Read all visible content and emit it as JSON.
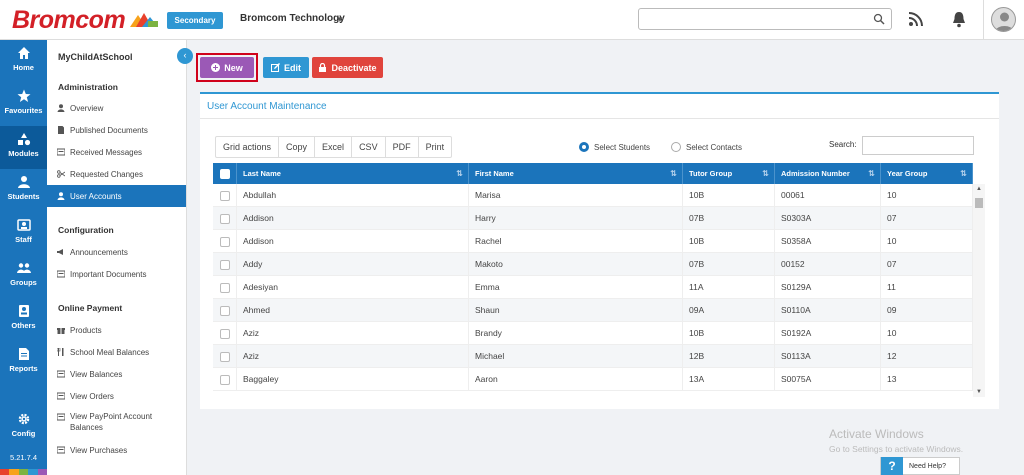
{
  "header": {
    "logo": "Bromcom",
    "secondary_label": "Secondary",
    "organisation": "Bromcom Technology",
    "search_placeholder": ""
  },
  "leftnav": {
    "items": [
      {
        "label": "Home",
        "icon": "home-icon"
      },
      {
        "label": "Favourites",
        "icon": "star-icon"
      },
      {
        "label": "Modules",
        "icon": "modules-icon"
      },
      {
        "label": "Students",
        "icon": "students-icon"
      },
      {
        "label": "Staff",
        "icon": "staff-icon"
      },
      {
        "label": "Groups",
        "icon": "groups-icon"
      },
      {
        "label": "Others",
        "icon": "others-icon"
      },
      {
        "label": "Reports",
        "icon": "reports-icon"
      },
      {
        "label": "Config",
        "icon": "config-icon"
      }
    ],
    "version": "5.21.7.4"
  },
  "sidebar": {
    "title": "MyChildAtSchool",
    "sections": [
      {
        "title": "Administration",
        "items": [
          "Overview",
          "Published Documents",
          "Received Messages",
          "Requested Changes",
          "User Accounts"
        ]
      },
      {
        "title": "Configuration",
        "items": [
          "Announcements",
          "Important Documents"
        ]
      },
      {
        "title": "Online Payment",
        "items": [
          "Products",
          "School Meal Balances",
          "View Balances",
          "View Orders",
          "View PayPoint Account Balances",
          "View Purchases"
        ]
      }
    ]
  },
  "toolbar": {
    "new_label": "New",
    "edit_label": "Edit",
    "deactivate_label": "Deactivate"
  },
  "panel": {
    "title": "User Account Maintenance",
    "grid_actions": [
      "Grid actions",
      "Copy",
      "Excel",
      "CSV",
      "PDF",
      "Print"
    ],
    "radio_students": "Select Students",
    "radio_contacts": "Select Contacts",
    "search_label": "Search:",
    "search_value": ""
  },
  "table": {
    "columns": [
      "Last Name",
      "First Name",
      "Tutor Group",
      "Admission Number",
      "Year Group"
    ],
    "rows": [
      [
        "Abdullah",
        "Marisa",
        "10B",
        "00061",
        "10"
      ],
      [
        "Addison",
        "Harry",
        "07B",
        "S0303A",
        "07"
      ],
      [
        "Addison",
        "Rachel",
        "10B",
        "S0358A",
        "10"
      ],
      [
        "Addy",
        "Makoto",
        "07B",
        "00152",
        "07"
      ],
      [
        "Adesiyan",
        "Emma",
        "11A",
        "S0129A",
        "11"
      ],
      [
        "Ahmed",
        "Shaun",
        "09A",
        "S0110A",
        "09"
      ],
      [
        "Aziz",
        "Brandy",
        "10B",
        "S0192A",
        "10"
      ],
      [
        "Aziz",
        "Michael",
        "12B",
        "S0113A",
        "12"
      ],
      [
        "Baggaley",
        "Aaron",
        "13A",
        "S0075A",
        "13"
      ]
    ]
  },
  "watermark": {
    "line1": "Activate Windows",
    "line2": "Go to Settings to activate Windows."
  },
  "help": {
    "q": "?",
    "label": "Need Help?"
  },
  "colors": {
    "brand_red": "#d32027",
    "primary_blue": "#1b74bb",
    "accent_blue": "#2f97d3",
    "new_purple": "#9b59b6",
    "deactivate_red": "#e0443c"
  }
}
